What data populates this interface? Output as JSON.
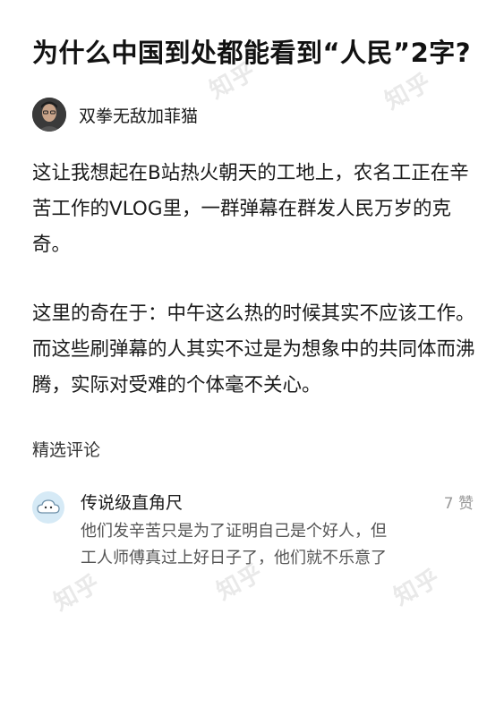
{
  "watermark": "知乎",
  "question": {
    "title": "为什么中国到处都能看到“人民”2字?"
  },
  "author": {
    "name": "双拳无敌加菲猫",
    "avatar_icon": "person-avatar-icon"
  },
  "answer": {
    "paragraphs": [
      "这让我想起在B站热火朝天的工地上，农名工正在辛苦工作的VLOG里，一群弹幕在群发人民万岁的克奇。",
      "这里的奇在于：中午这么热的时候其实不应该工作。而这些刷弹幕的人其实不过是为想象中的共同体而沸腾，实际对受难的个体毫不关心。"
    ]
  },
  "comments_section": {
    "label": "精选评论"
  },
  "comments": [
    {
      "author": "传说级直角尺",
      "likes": "7 赞",
      "text": "他们发辛苦只是为了证明自己是个好人，但工人师傅真过上好日子了，他们就不乐意了",
      "avatar_icon": "cloud-avatar-icon"
    }
  ],
  "colors": {
    "watermark": "#e9e9e9",
    "title": "#121212",
    "body": "#1a1a1a",
    "muted": "#999999",
    "comment_text": "#555555",
    "comment_avatar_bg": "#d6eaf6"
  }
}
